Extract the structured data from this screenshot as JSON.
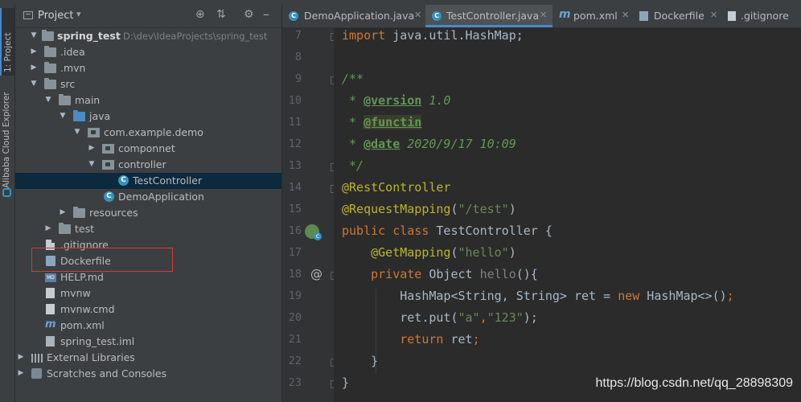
{
  "sidebar": {
    "project_tab": "1: Project",
    "cloud_tab": "Alibaba Cloud Explorer"
  },
  "panel": {
    "title": "Project",
    "tree": [
      {
        "label": "spring_test",
        "path": "D:\\dev\\IdeaProjects\\spring_test"
      },
      {
        "label": ".idea"
      },
      {
        "label": ".mvn"
      },
      {
        "label": "src"
      },
      {
        "label": "main"
      },
      {
        "label": "java"
      },
      {
        "label": "com.example.demo"
      },
      {
        "label": "componnet"
      },
      {
        "label": "controller"
      },
      {
        "label": "TestController"
      },
      {
        "label": "DemoApplication"
      },
      {
        "label": "resources"
      },
      {
        "label": "test"
      },
      {
        "label": ".gitignore"
      },
      {
        "label": "Dockerfile"
      },
      {
        "label": "HELP.md"
      },
      {
        "label": "mvnw"
      },
      {
        "label": "mvnw.cmd"
      },
      {
        "label": "pom.xml"
      },
      {
        "label": "spring_test.iml"
      },
      {
        "label": "External Libraries"
      },
      {
        "label": "Scratches and Consoles"
      }
    ]
  },
  "tabs": [
    {
      "label": "DemoApplication.java",
      "icon": "class-icon"
    },
    {
      "label": "TestController.java",
      "icon": "class-icon",
      "active": true
    },
    {
      "label": "pom.xml",
      "icon": "maven-icon"
    },
    {
      "label": "Dockerfile",
      "icon": "docker-icon"
    },
    {
      "label": ".gitignore",
      "icon": "gitignore-icon"
    }
  ],
  "editor": {
    "line_numbers": [
      "7",
      "8",
      "9",
      "10",
      "11",
      "12",
      "13",
      "14",
      "15",
      "16",
      "17",
      "18",
      "19",
      "20",
      "21",
      "22",
      "23"
    ],
    "code": {
      "import_kw": "import",
      "import_path": " java.util.HashMap;",
      "doc_open": "/**",
      "tag_version": "@version",
      "val_version": " 1.0",
      "tag_functin": "@functin",
      "tag_date": "@date",
      "val_date": " 2020/9/17 10:09",
      "doc_close": " */",
      "ann_rest": "@RestController",
      "ann_mapping": "@RequestMapping",
      "str_test": "\"/test\"",
      "kw_public_class": "public class",
      "class_name": " TestController {",
      "ann_get": "@GetMapping",
      "str_hello": "\"hello\"",
      "kw_private": "private",
      "method_type": " Object ",
      "method_name": "hello",
      "method_rest": "(){",
      "hashmap_decl": "HashMap<String, String> ret = ",
      "kw_new": "new",
      "hashmap_init": " HashMap<>()",
      "put_call": "ret.put(",
      "str_a": "\"a\"",
      "str_123": "\"123\"",
      "put_end": ");",
      "kw_return": "return",
      "return_rest": " ret",
      "close_method": "}",
      "close_class": "}"
    }
  },
  "watermark": "https://blog.csdn.net/qq_28898309",
  "colors": {
    "background": "#2b2b2b",
    "panel": "#3c3f41",
    "selection": "#0d293e",
    "highlight_box": "#d23a3a",
    "keyword": "#cc7832",
    "annotation": "#bbb529",
    "string": "#6a8759"
  }
}
